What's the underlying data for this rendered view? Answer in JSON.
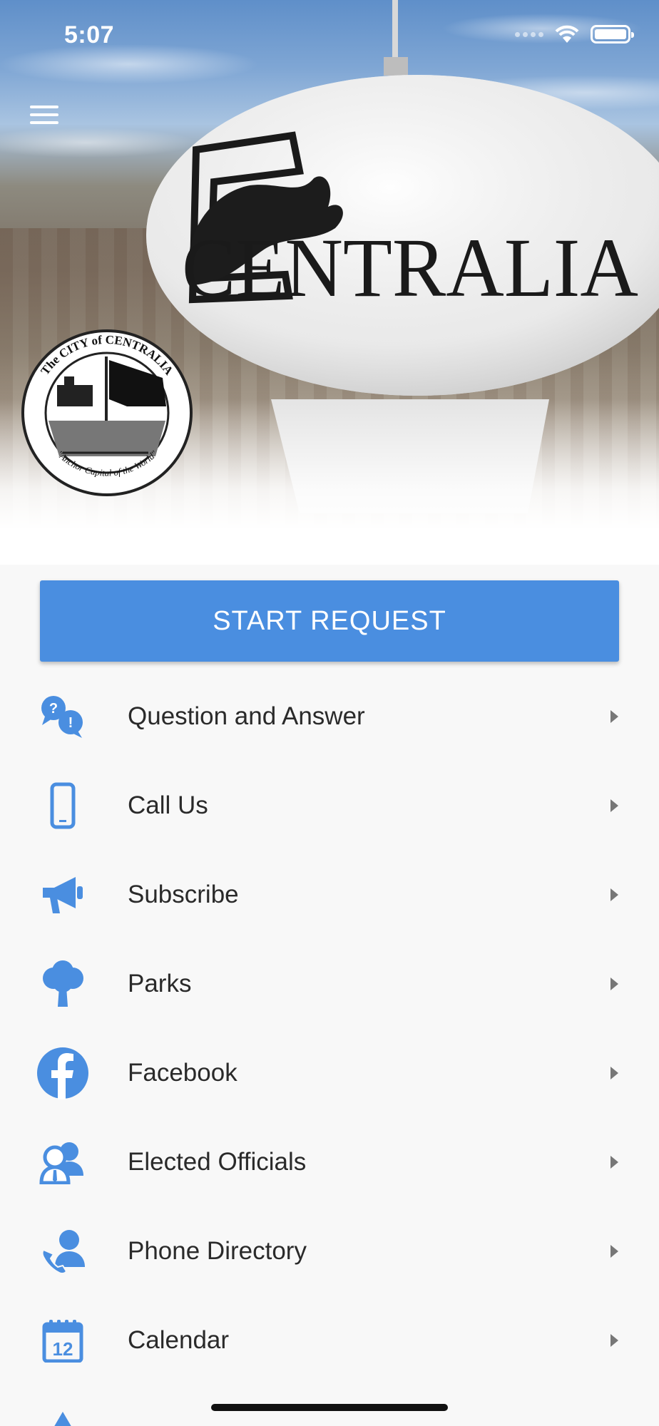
{
  "status_bar": {
    "time": "5:07"
  },
  "header": {
    "tower_text": "CENTRALIA",
    "seal": {
      "top_text": "The CITY of CENTRALIA",
      "bottom_text": "\"Anchor Capital of the World\""
    }
  },
  "main": {
    "start_request_label": "START REQUEST",
    "items": [
      {
        "label": "Question and Answer",
        "icon": "question-answer-icon"
      },
      {
        "label": "Call Us",
        "icon": "mobile-phone-icon"
      },
      {
        "label": "Subscribe",
        "icon": "megaphone-icon"
      },
      {
        "label": "Parks",
        "icon": "tree-icon"
      },
      {
        "label": "Facebook",
        "icon": "facebook-icon"
      },
      {
        "label": "Elected Officials",
        "icon": "people-icon"
      },
      {
        "label": "Phone Directory",
        "icon": "contact-phone-icon"
      },
      {
        "label": "Calendar",
        "icon": "calendar-icon"
      }
    ]
  },
  "colors": {
    "accent": "#4a8ee0",
    "text": "#2a2a2a",
    "background": "#f8f8f8"
  }
}
